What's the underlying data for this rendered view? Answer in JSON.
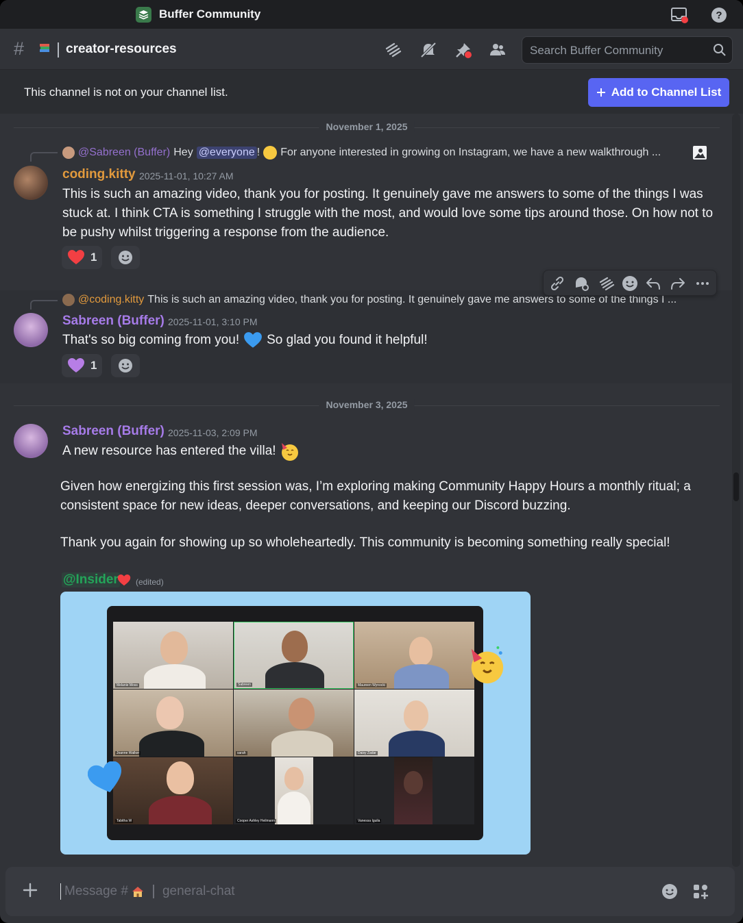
{
  "window": {
    "title": "Buffer Community"
  },
  "channel": {
    "name": "creator-resources",
    "emoji": "books-icon"
  },
  "search": {
    "placeholder": "Search Buffer Community"
  },
  "notice": {
    "text": "This channel is not on your channel list.",
    "button_label": "Add to Channel List"
  },
  "dividers": [
    "November 1, 2025",
    "November 3, 2025"
  ],
  "messages": [
    {
      "reply_to": {
        "author": "@Sabreen (Buffer)",
        "prefix": "Hey",
        "mention": "@everyone",
        "excl": "!",
        "text": "For anyone interested in growing on Instagram, we have a new walkthrough ..."
      },
      "author": "coding.kitty",
      "author_color": "#e29a3d",
      "timestamp": "2025-11-01, 10:27 AM",
      "text": "This is such an amazing video, thank you for posting. It genuinely gave me answers to some of the things I was stuck at. I think CTA is something I struggle with the most, and would love some tips around those. On how not to be pushy whilst triggering a response from the audience.",
      "reaction": {
        "emoji": "red-heart-icon",
        "count": "1"
      }
    },
    {
      "reply_to": {
        "author": "@coding.kitty",
        "text": "This is such an amazing video, thank you for posting. It genuinely gave me answers to some of the things I ..."
      },
      "author": "Sabreen (Buffer)",
      "author_color": "#a67be8",
      "timestamp": "2025-11-01, 3:10 PM",
      "text_before": "That's so big coming from you!",
      "text_after": "So glad you found it helpful!",
      "reaction": {
        "emoji": "purple-heart-icon",
        "count": "1"
      }
    },
    {
      "author": "Sabreen (Buffer)",
      "author_color": "#a67be8",
      "timestamp": "2025-11-03, 2:09 PM",
      "line1": "A new resource has entered the villa!",
      "para1": "Given how energizing this first session was, I’m exploring making Community Happy Hours a monthly ritual;  a consistent space for new ideas, deeper conversations, and keeping our Discord buzzing.",
      "para2": "Thank you again for showing up so wholeheartedly. This community is becoming something really special!",
      "role_mention": "@Insider",
      "edited": "(edited)",
      "participants": [
        "Melanie Moss",
        "Sabreen",
        "Maureen Wynocki",
        "Joanne Walker",
        "sarah",
        "Daisy Zadar",
        "Tabitha W",
        "Cooper Ashley Heilmann",
        "Vanessa Iguila"
      ]
    }
  ],
  "composer": {
    "placeholder_prefix": "Message #",
    "placeholder_channel": "general-chat"
  },
  "colors": {
    "accent": "#5865f2",
    "background": "#313338",
    "titlebar": "#1e1f22",
    "insider_green": "#23a559"
  }
}
